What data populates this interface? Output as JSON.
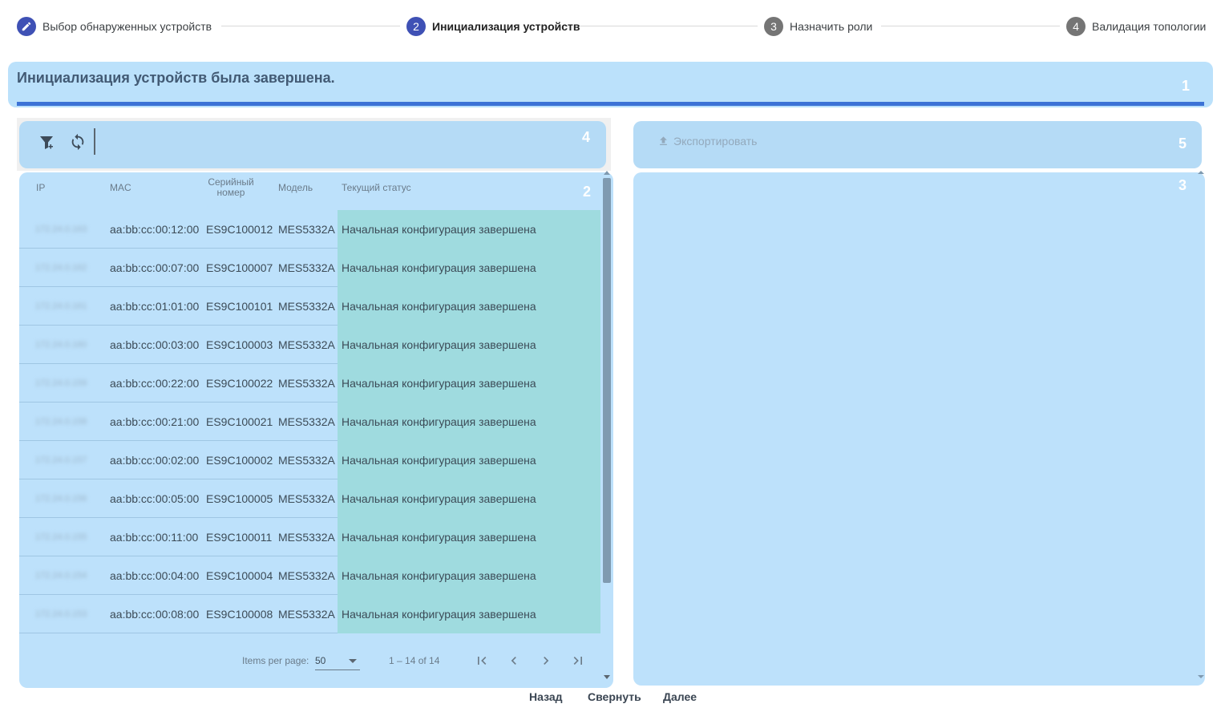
{
  "stepper": {
    "steps": [
      {
        "number": "",
        "label": "Выбор обнаруженных устройств",
        "state": "done",
        "icon": "pencil-icon"
      },
      {
        "number": "2",
        "label": "Инициализация устройств",
        "state": "active"
      },
      {
        "number": "3",
        "label": "Назначить роли",
        "state": "pending"
      },
      {
        "number": "4",
        "label": "Валидация топологии",
        "state": "pending"
      }
    ]
  },
  "banner": {
    "title": "Инициализация устройств была завершена.",
    "region": "1"
  },
  "left_toolbar": {
    "icons": [
      "filter-add-icon",
      "refresh-icon"
    ],
    "region": "4"
  },
  "right_toolbar": {
    "export_label": "Экспортировать",
    "export_icon": "upload-icon",
    "region": "5"
  },
  "table": {
    "region": "2",
    "headers": {
      "ip": "IP",
      "mac": "MAC",
      "serial_line1": "Серийный",
      "serial_line2": "номер",
      "model": "Модель",
      "status": "Текущий статус"
    },
    "rows": [
      {
        "ip": "172.24.0.163",
        "mac": "aa:bb:cc:00:12:00",
        "serial": "ES9C100012",
        "model": "MES5332A",
        "status": "Начальная конфигурация завершена"
      },
      {
        "ip": "172.24.0.162",
        "mac": "aa:bb:cc:00:07:00",
        "serial": "ES9C100007",
        "model": "MES5332A",
        "status": "Начальная конфигурация завершена"
      },
      {
        "ip": "172.24.0.161",
        "mac": "aa:bb:cc:01:01:00",
        "serial": "ES9C100101",
        "model": "MES5332A",
        "status": "Начальная конфигурация завершена"
      },
      {
        "ip": "172.24.0.160",
        "mac": "aa:bb:cc:00:03:00",
        "serial": "ES9C100003",
        "model": "MES5332A",
        "status": "Начальная конфигурация завершена"
      },
      {
        "ip": "172.24.0.159",
        "mac": "aa:bb:cc:00:22:00",
        "serial": "ES9C100022",
        "model": "MES5332A",
        "status": "Начальная конфигурация завершена"
      },
      {
        "ip": "172.24.0.158",
        "mac": "aa:bb:cc:00:21:00",
        "serial": "ES9C100021",
        "model": "MES5332A",
        "status": "Начальная конфигурация завершена"
      },
      {
        "ip": "172.24.0.157",
        "mac": "aa:bb:cc:00:02:00",
        "serial": "ES9C100002",
        "model": "MES5332A",
        "status": "Начальная конфигурация завершена"
      },
      {
        "ip": "172.24.0.156",
        "mac": "aa:bb:cc:00:05:00",
        "serial": "ES9C100005",
        "model": "MES5332A",
        "status": "Начальная конфигурация завершена"
      },
      {
        "ip": "172.24.0.155",
        "mac": "aa:bb:cc:00:11:00",
        "serial": "ES9C100011",
        "model": "MES5332A",
        "status": "Начальная конфигурация завершена"
      },
      {
        "ip": "172.24.0.154",
        "mac": "aa:bb:cc:00:04:00",
        "serial": "ES9C100004",
        "model": "MES5332A",
        "status": "Начальная конфигурация завершена"
      },
      {
        "ip": "172.24.0.153",
        "mac": "aa:bb:cc:00:08:00",
        "serial": "ES9C100008",
        "model": "MES5332A",
        "status": "Начальная конфигурация завершена"
      }
    ]
  },
  "paginator": {
    "items_per_page_label": "Items per page:",
    "items_per_page_value": "50",
    "range_label": "1 – 14 of 14",
    "buttons": [
      "first-page-icon",
      "prev-page-icon",
      "next-page-icon",
      "last-page-icon"
    ]
  },
  "right_panel": {
    "region": "3"
  },
  "footer": {
    "back_label": "Назад",
    "collapse_label": "Свернуть",
    "next_label": "Далее"
  },
  "colors": {
    "accent": "#3f51b5",
    "panel": "#bde1fb",
    "status_cell": "#9fdbdf",
    "banner_bar": "#3c72d6"
  }
}
